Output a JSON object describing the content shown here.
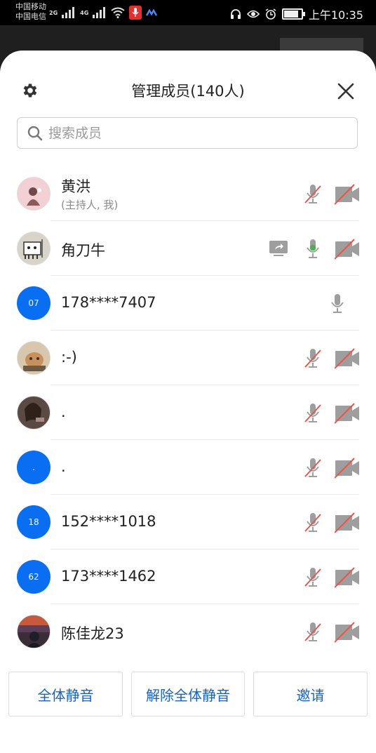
{
  "status_bar": {
    "carrier1": "中国移动",
    "carrier2": "中国电信",
    "net1": "2G",
    "net2": "4G",
    "time": "上午10:35"
  },
  "header": {
    "title": "管理成员(140人)",
    "settings_icon": "gear-icon",
    "close_icon": "close-icon"
  },
  "search": {
    "placeholder": "搜索成员",
    "value": ""
  },
  "members": [
    {
      "name": "黄洪",
      "subtitle": "(主持人, 我)",
      "avatar_text": "",
      "share": false,
      "mic": "muted",
      "video": "off"
    },
    {
      "name": "角刀牛",
      "subtitle": "",
      "avatar_text": "",
      "share": true,
      "mic": "active",
      "video": "off"
    },
    {
      "name": "178****7407",
      "subtitle": "",
      "avatar_text": "07",
      "share": false,
      "mic": "on",
      "video": "none"
    },
    {
      "name": ":-)",
      "subtitle": "",
      "avatar_text": "",
      "share": false,
      "mic": "muted",
      "video": "off"
    },
    {
      "name": ".",
      "subtitle": "",
      "avatar_text": "",
      "share": false,
      "mic": "muted",
      "video": "off"
    },
    {
      "name": ".",
      "subtitle": "",
      "avatar_text": ".",
      "share": false,
      "mic": "muted",
      "video": "off"
    },
    {
      "name": "152****1018",
      "subtitle": "",
      "avatar_text": "18",
      "share": false,
      "mic": "muted",
      "video": "off"
    },
    {
      "name": "173****1462",
      "subtitle": "",
      "avatar_text": "62",
      "share": false,
      "mic": "muted",
      "video": "off"
    },
    {
      "name": "陈佳龙23",
      "subtitle": "",
      "avatar_text": "",
      "share": false,
      "mic": "muted",
      "video": "off"
    }
  ],
  "footer": {
    "mute_all": "全体静音",
    "unmute_all": "解除全体静音",
    "invite": "邀请"
  },
  "colors": {
    "accent": "#0a6ef2",
    "button_text": "#1565c0",
    "mute_slash": "#e05a4f",
    "mic_active": "#4caf50"
  }
}
